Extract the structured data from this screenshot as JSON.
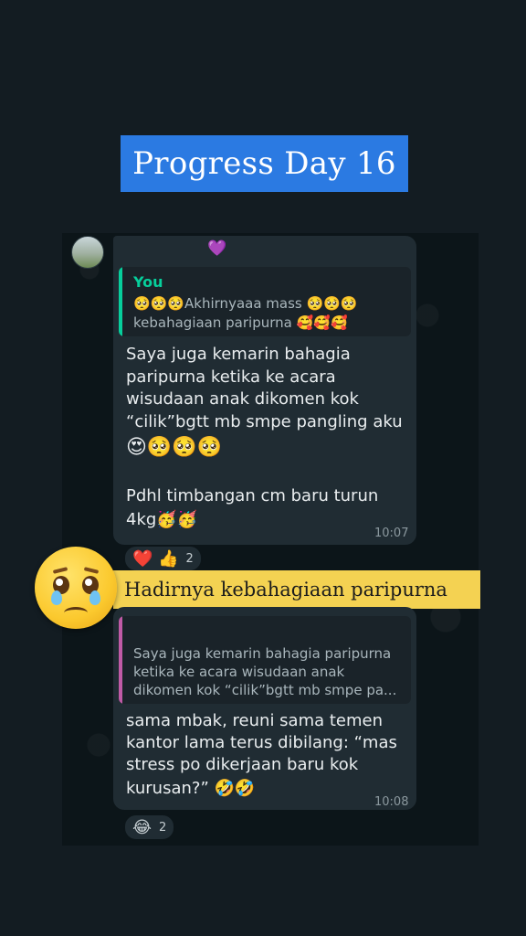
{
  "title_banner": "Progress Day 16",
  "colors": {
    "background": "#131c22",
    "title_banner_bg": "#2b7ae2",
    "caption_banner_bg": "#f4d252",
    "bubble_bg": "#202c33",
    "quote_accent_1": "#06cf9c",
    "quote_accent_2": "#c05aa6",
    "sender_heart": "#9b5cf6"
  },
  "message_1": {
    "sender_heart": "💜",
    "quote_author": "You",
    "quote_lines": [
      "🥺🥺🥺Akhirnyaaa mass 🥺🥺🥺",
      "kebahagiaan paripurna 🥰🥰🥰"
    ],
    "text_lines": [
      "Saya juga kemarin bahagia",
      "paripurna ketika ke acara",
      "wisudaan anak dikomen kok",
      "“cilik”bgtt mb smpe pangling aku",
      "😍🥺🥺🥺",
      "Pdhl timbangan cm baru turun",
      "4kg🥳🥳"
    ],
    "time": "10:07",
    "reactions": "❤️ 👍",
    "reaction_count": "2"
  },
  "caption_banner": "Hadirnya kebahagiaan paripurna",
  "big_emoji_icon": "pleading-face-icon",
  "message_2": {
    "sender_heart": "💜",
    "quote_lines": [
      "Saya juga kemarin bahagia paripurna",
      "ketika ke acara wisudaan anak",
      "dikomen kok “cilik”bgtt mb smpe pa..."
    ],
    "text_lines": [
      "sama mbak, reuni sama temen",
      "kantor lama terus dibilang: “mas",
      "stress po dikerjaan baru kok",
      "kurusan?” 🤣🤣"
    ],
    "time": "10:08",
    "reactions": "😂",
    "reaction_count": "2"
  }
}
